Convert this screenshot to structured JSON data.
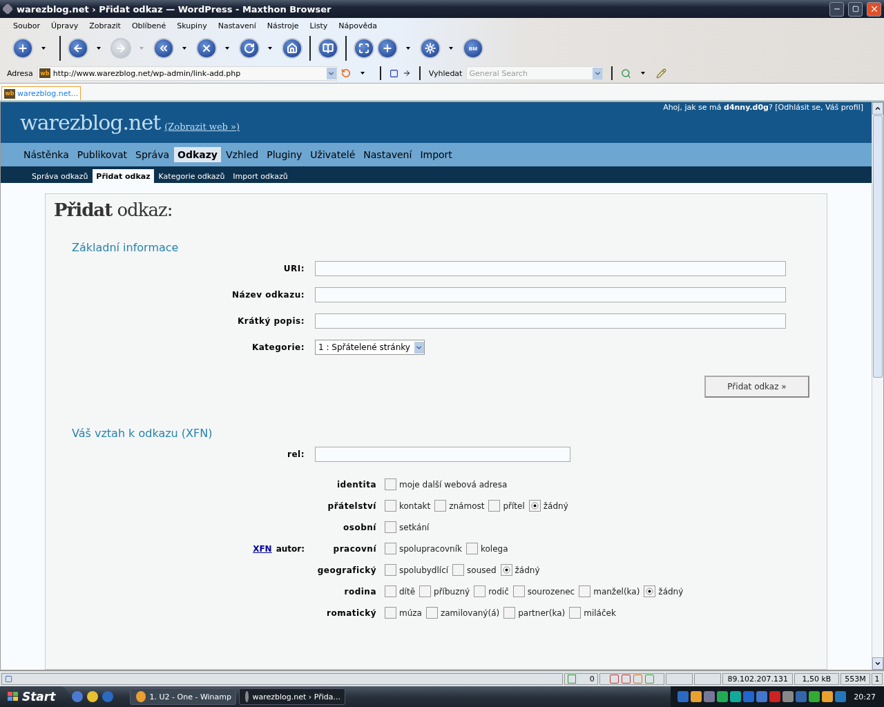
{
  "window": {
    "title": "warezblog.net › Přidat odkaz — WordPress - Maxthon Browser"
  },
  "menu": [
    "Soubor",
    "Úpravy",
    "Zobrazit",
    "Oblíbené",
    "Skupiny",
    "Nastavení",
    "Nástroje",
    "Listy",
    "Nápověda"
  ],
  "toolbar_buttons": [
    {
      "dropdown": true,
      "disabled": false
    },
    {
      "dropdown": true,
      "disabled": false
    },
    {
      "dropdown": true,
      "disabled": true
    },
    {
      "dropdown": true,
      "disabled": false
    },
    {
      "dropdown": true,
      "disabled": false
    },
    {
      "dropdown": true,
      "disabled": false
    },
    {
      "dropdown": false,
      "disabled": false
    },
    {
      "dropdown": false,
      "disabled": false
    },
    {
      "dropdown": false,
      "disabled": false
    },
    {
      "dropdown": true,
      "disabled": false
    },
    {
      "dropdown": true,
      "disabled": false
    },
    {
      "dropdown": false,
      "disabled": false,
      "text": "BM"
    }
  ],
  "address_bar": {
    "label": "Adresa",
    "favicon": "wb",
    "url": "http://www.warezblog.net/wp-admin/link-add.php"
  },
  "search": {
    "label": "Vyhledat",
    "placeholder": "General Search"
  },
  "browser_tabs": [
    {
      "favicon": "wb",
      "label": "warezblog.net...",
      "selected": true
    }
  ],
  "page": {
    "site_title": "warezblog.net",
    "view_site": "(Zobrazit web »)",
    "greeting": "Ahoj, jak se má **d4nny.d0g**? [Odhlásit se, Váš profil]",
    "nav": [
      {
        "label": "Nástěnka",
        "selected": false
      },
      {
        "label": "Publikovat",
        "selected": false
      },
      {
        "label": "Správa",
        "selected": false
      },
      {
        "label": "Odkazy",
        "selected": true
      },
      {
        "label": "Vzhled",
        "selected": false
      },
      {
        "label": "Pluginy",
        "selected": false
      },
      {
        "label": "Uživatelé",
        "selected": false
      },
      {
        "label": "Nastavení",
        "selected": false
      },
      {
        "label": "Import",
        "selected": false
      }
    ],
    "subnav": [
      {
        "label": "Správa odkazů",
        "selected": false
      },
      {
        "label": "Přidat odkaz",
        "selected": true
      },
      {
        "label": "Kategorie odkazů",
        "selected": false
      },
      {
        "label": "Import odkazů",
        "selected": false
      }
    ],
    "heading": "**Přidat** odkaz:",
    "basic": {
      "title": "Základní informace",
      "fields": [
        {
          "label": "URI:",
          "kind": "text"
        },
        {
          "label": "Název odkazu:",
          "kind": "text"
        },
        {
          "label": "Krátký popis:",
          "kind": "text"
        },
        {
          "label": "Kategorie:",
          "kind": "select",
          "value": "1 : Spřátelené stránky"
        }
      ],
      "submit": "Přidat odkaz »"
    },
    "xfn": {
      "title": "Váš vztah k odkazu (XFN)",
      "rel_label": "rel:",
      "author_link": "XFN",
      "author_label": "autor:",
      "groups": [
        {
          "label": "identita",
          "options": [
            {
              "kind": "checkbox",
              "label": "moje další webová adresa",
              "checked": false
            }
          ]
        },
        {
          "label": "přátelství",
          "options": [
            {
              "kind": "radio",
              "label": "kontakt",
              "checked": false
            },
            {
              "kind": "radio",
              "label": "známost",
              "checked": false
            },
            {
              "kind": "radio",
              "label": "přítel",
              "checked": false
            },
            {
              "kind": "radio",
              "label": "žádný",
              "checked": true
            }
          ]
        },
        {
          "label": "osobní",
          "options": [
            {
              "kind": "checkbox",
              "label": "setkání",
              "checked": false
            }
          ]
        },
        {
          "label": "pracovní",
          "options": [
            {
              "kind": "checkbox",
              "label": "spolupracovník",
              "checked": false
            },
            {
              "kind": "checkbox",
              "label": "kolega",
              "checked": false
            }
          ]
        },
        {
          "label": "geografický",
          "options": [
            {
              "kind": "radio",
              "label": "spolubydlící",
              "checked": false
            },
            {
              "kind": "radio",
              "label": "soused",
              "checked": false
            },
            {
              "kind": "radio",
              "label": "žádný",
              "checked": true
            }
          ]
        },
        {
          "label": "rodina",
          "options": [
            {
              "kind": "radio",
              "label": "dítě",
              "checked": false
            },
            {
              "kind": "radio",
              "label": "příbuzný",
              "checked": false
            },
            {
              "kind": "radio",
              "label": "rodič",
              "checked": false
            },
            {
              "kind": "radio",
              "label": "sourozenec",
              "checked": false
            },
            {
              "kind": "radio",
              "label": "manžel(ka)",
              "checked": false
            },
            {
              "kind": "radio",
              "label": "žádný",
              "checked": true
            }
          ]
        },
        {
          "label": "romatický",
          "options": [
            {
              "kind": "checkbox",
              "label": "múza",
              "checked": false
            },
            {
              "kind": "checkbox",
              "label": "zamilovaný(á)",
              "checked": false
            },
            {
              "kind": "checkbox",
              "label": "partner(ka)",
              "checked": false
            },
            {
              "kind": "checkbox",
              "label": "miláček",
              "checked": false
            }
          ]
        }
      ]
    }
  },
  "status_bar": {
    "popup_count": "0",
    "ip": "89.102.207.131",
    "size": "1,50 kB",
    "memory": "553M",
    "count": "1"
  },
  "taskbar": {
    "start": "Start",
    "tasks": [
      {
        "label": "1. U2 - One - Winamp",
        "selected": false
      },
      {
        "label": "warezblog.net › Přida...",
        "selected": true
      }
    ],
    "clock": "20:27"
  }
}
